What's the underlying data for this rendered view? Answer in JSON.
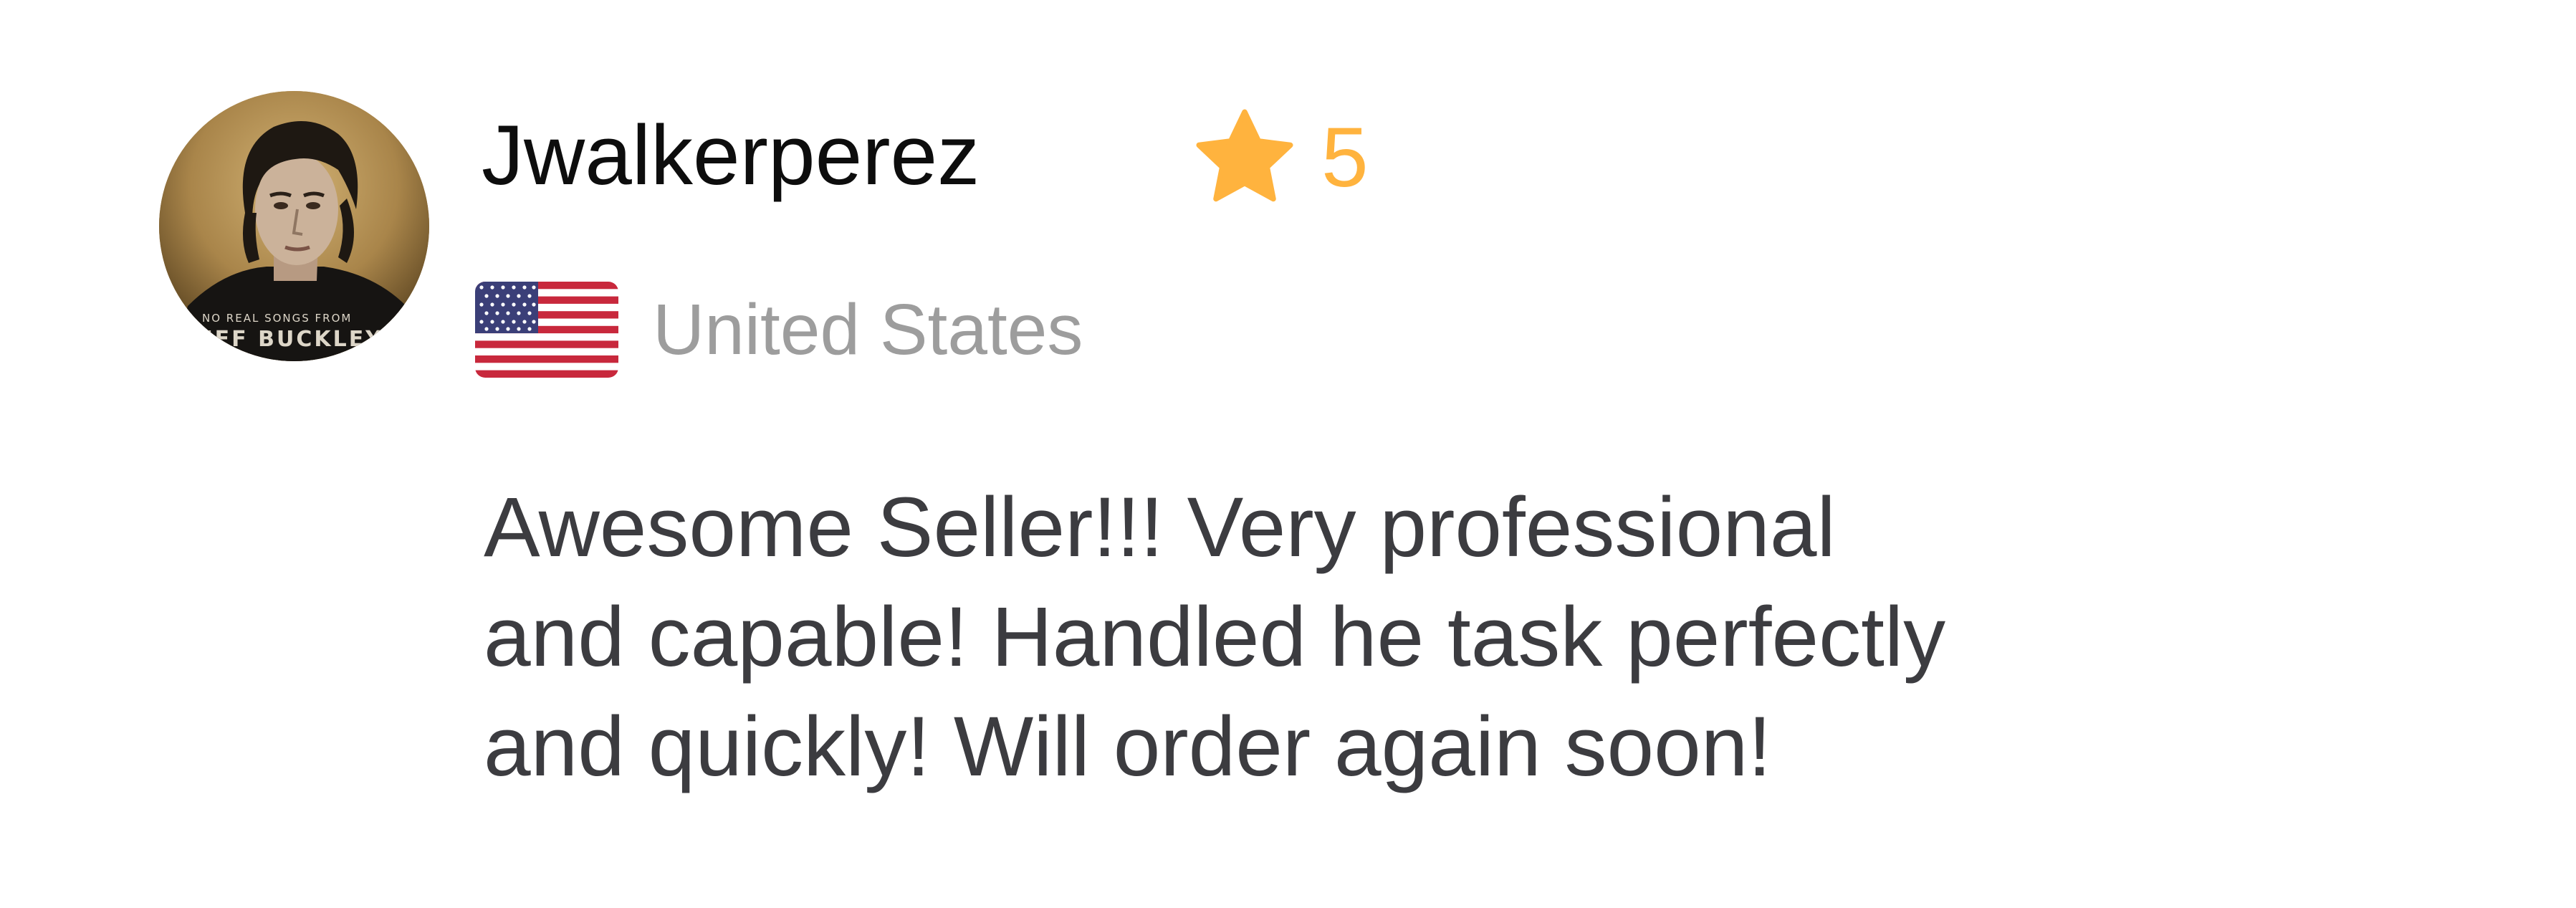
{
  "review": {
    "reviewer_name": "Jwalkerperez",
    "avatar_icon": "profile-photo",
    "avatar_overlay_text": {
      "line1": "NO REAL SONGS FROM",
      "line2": "JEFF BUCKLEY"
    },
    "rating": {
      "icon": "star-icon",
      "value": "5",
      "color": "#ffb33e"
    },
    "country": {
      "icon": "us-flag-icon",
      "name": "United States"
    },
    "text_lines": [
      "Awesome Seller!!! Very professional",
      "and capable! Handled he task perfectly",
      "and quickly! Will order again soon!"
    ],
    "colors": {
      "name": "#0d0d0d",
      "country": "#9d9d9d",
      "body": "#3c3c40"
    }
  }
}
